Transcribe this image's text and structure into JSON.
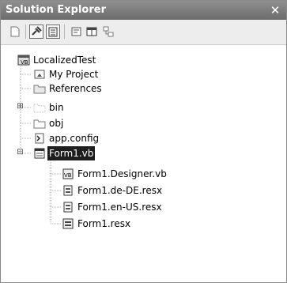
{
  "window": {
    "title": "Solution Explorer",
    "close_glyph": "✕"
  },
  "toolbar": {
    "buttons": [
      {
        "name": "refresh-icon"
      },
      {
        "name": "properties-icon"
      },
      {
        "name": "show-all-files-icon"
      },
      {
        "name": "view-code-icon"
      },
      {
        "name": "view-designer-icon"
      },
      {
        "name": "class-diagram-icon"
      }
    ]
  },
  "tree": {
    "project": "LocalizedTest",
    "items": [
      {
        "label": "My Project"
      },
      {
        "label": "References"
      },
      {
        "label": "bin"
      },
      {
        "label": "obj"
      },
      {
        "label": "app.config"
      },
      {
        "label": "Form1.vb"
      }
    ],
    "children": [
      {
        "label": "Form1.Designer.vb"
      },
      {
        "label": "Form1.de-DE.resx"
      },
      {
        "label": "Form1.en-US.resx"
      },
      {
        "label": "Form1.resx"
      }
    ]
  },
  "colors": {
    "titlebar": "#7c7c7c",
    "selection": "#1e1e1e"
  }
}
